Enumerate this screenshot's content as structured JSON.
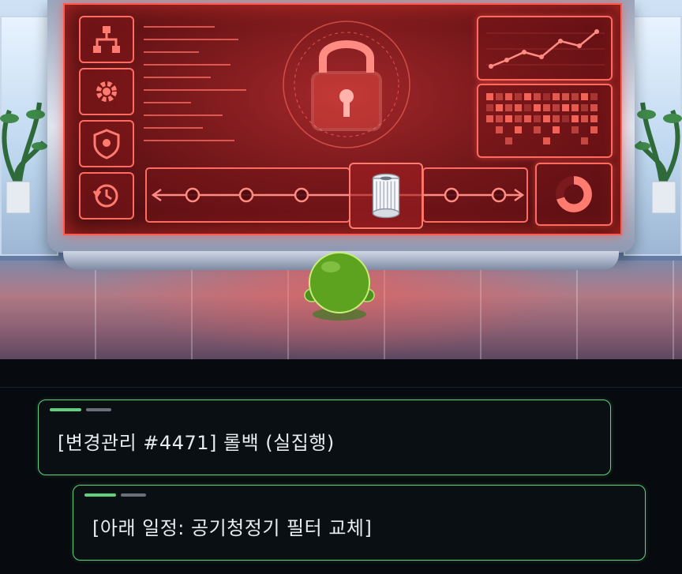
{
  "scene": {
    "icons": [
      "network-icon",
      "gear-icon",
      "shield-icon",
      "history-icon",
      "lock-icon",
      "filter-cartridge-icon",
      "line-chart-icon",
      "donut-chart-icon"
    ],
    "colors": {
      "screen": "#8a1d21",
      "accent": "#ff5a4e",
      "creature": "#5ea31f"
    }
  },
  "dialogue": {
    "line1": "[변경관리 #4471] 롤백 (실집행)",
    "line2": "[아래 일정: 공기청정기 필터 교체]",
    "accent_color": "#5fd07d"
  }
}
